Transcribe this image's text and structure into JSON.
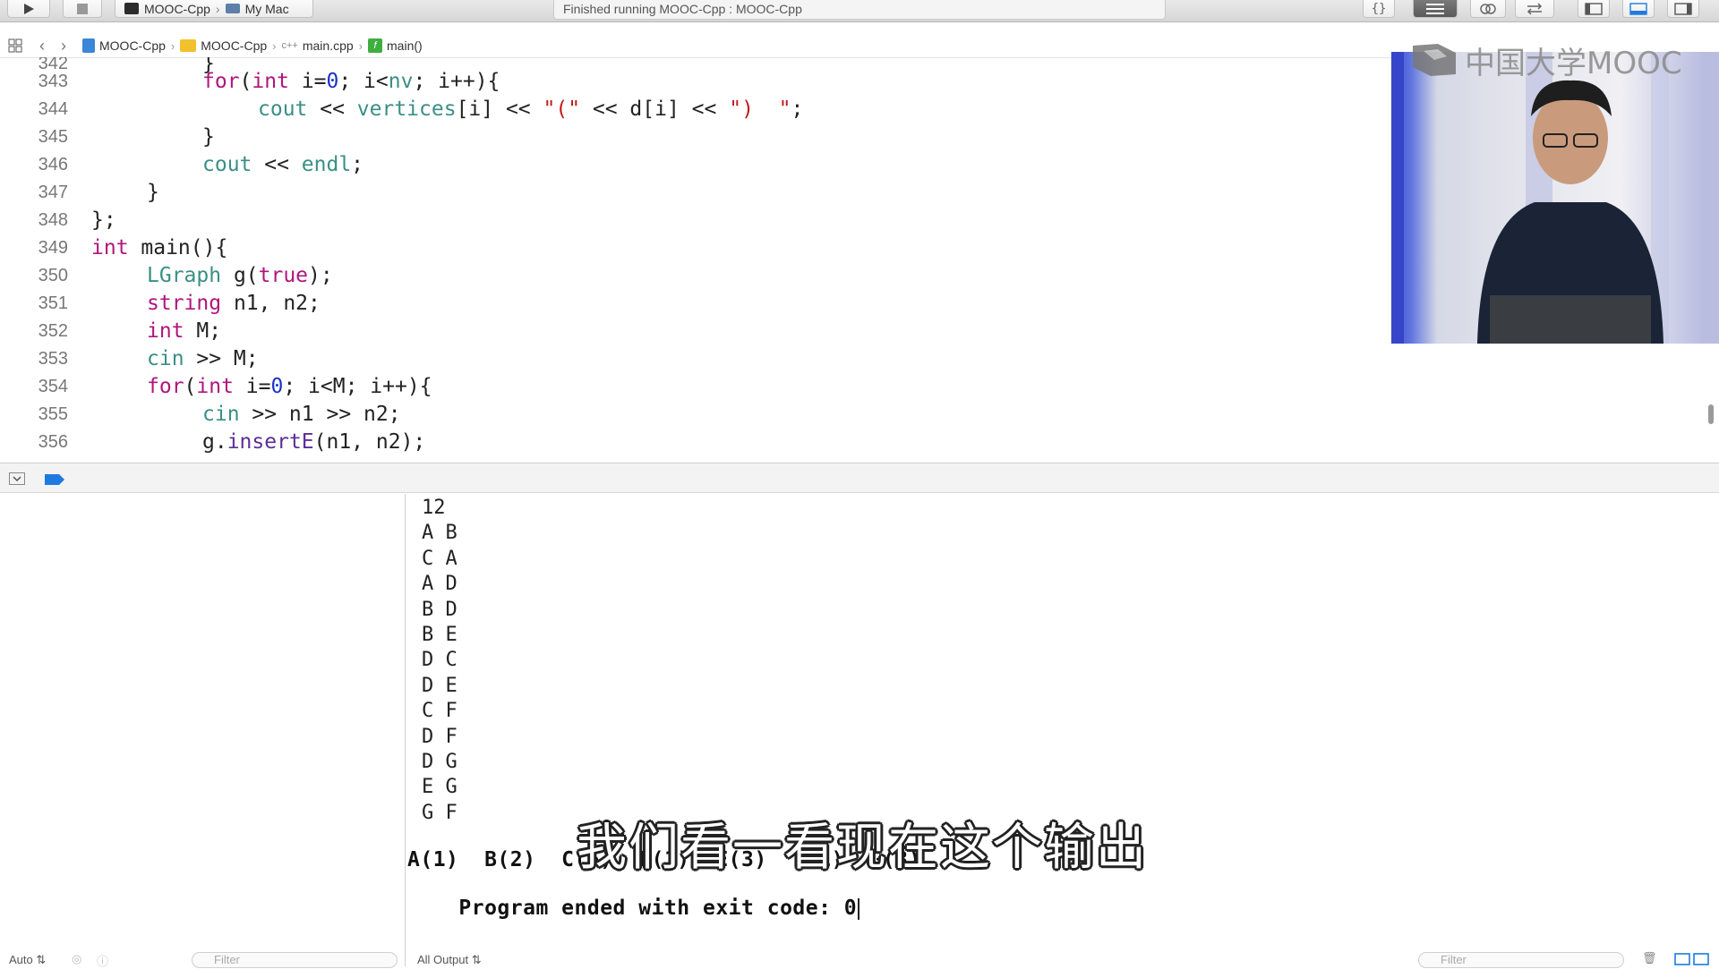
{
  "toolbar": {
    "scheme": "MOOC-Cpp",
    "destination": "My Mac",
    "activity": "Finished running MOOC-Cpp : MOOC-Cpp"
  },
  "jumpbar": {
    "crumbs": [
      "MOOC-Cpp",
      "MOOC-Cpp",
      "main.cpp",
      "main()"
    ]
  },
  "editor": {
    "top_partial_number": "342",
    "lines": [
      {
        "n": "343",
        "text": "for(int i=0; i<nv; i++){"
      },
      {
        "n": "344",
        "text": "cout << vertices[i] << \"(\" << d[i] << \")  \";"
      },
      {
        "n": "345",
        "text": "}"
      },
      {
        "n": "346",
        "text": "cout << endl;"
      },
      {
        "n": "347",
        "text": "}"
      },
      {
        "n": "348",
        "text": "};"
      },
      {
        "n": "349",
        "text": "int main(){"
      },
      {
        "n": "350",
        "text": "LGraph g(true);"
      },
      {
        "n": "351",
        "text": "string n1, n2;"
      },
      {
        "n": "352",
        "text": "int M;"
      },
      {
        "n": "353",
        "text": "cin >> M;"
      },
      {
        "n": "354",
        "text": "for(int i=0; i<M; i++){"
      },
      {
        "n": "355",
        "text": "cin >> n1 >> n2;"
      },
      {
        "n": "356",
        "text": "g.insertE(n1, n2);"
      }
    ]
  },
  "overlay": {
    "logo_text": "中国大学MOOC"
  },
  "console": {
    "input_lines": [
      "12",
      "A B",
      "C A",
      "A D",
      "B D",
      "B E",
      "D C",
      "D E",
      "C F",
      "D F",
      "D G",
      "E G",
      "G F"
    ],
    "result_line": "A(1)  B(2)  C(6)  D(1)  E(3)  F(1)  G(3)",
    "exit_line": "Program ended with exit code: 0",
    "subtitle": "我们看一看现在这个输出"
  },
  "bottom": {
    "auto_label": "Auto",
    "filter_left": "Filter",
    "output_selector": "All Output",
    "filter_right": "Filter"
  },
  "colors": {
    "keyword": "#b0157d",
    "type": "#3a8f86",
    "number": "#1a32c8",
    "string": "#c21a1a",
    "breakpoint_accent": "#1f7ae0"
  }
}
